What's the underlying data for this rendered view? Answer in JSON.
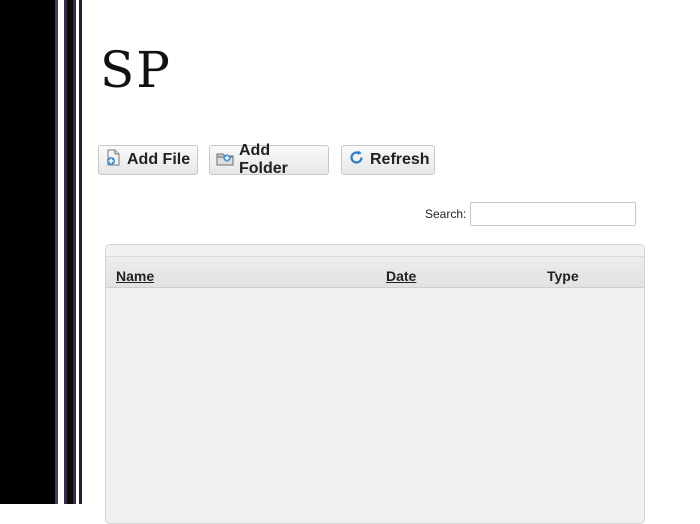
{
  "brand": {
    "logo_text": "SP"
  },
  "toolbar": {
    "add_file": "Add File",
    "add_folder": "Add Folder",
    "refresh": "Refresh"
  },
  "search": {
    "label": "Search:",
    "value": "",
    "placeholder": ""
  },
  "grid": {
    "columns": [
      {
        "label": "Name",
        "sortable": true
      },
      {
        "label": "Date",
        "sortable": true
      },
      {
        "label": "Type",
        "sortable": false
      }
    ],
    "rows": []
  },
  "icons": {
    "add_file": "add-file-icon",
    "add_folder": "add-folder-icon",
    "refresh": "refresh-icon"
  },
  "colors": {
    "background": "#ffffff",
    "band": "#000000",
    "grid_bg": "#f1f1f1"
  }
}
